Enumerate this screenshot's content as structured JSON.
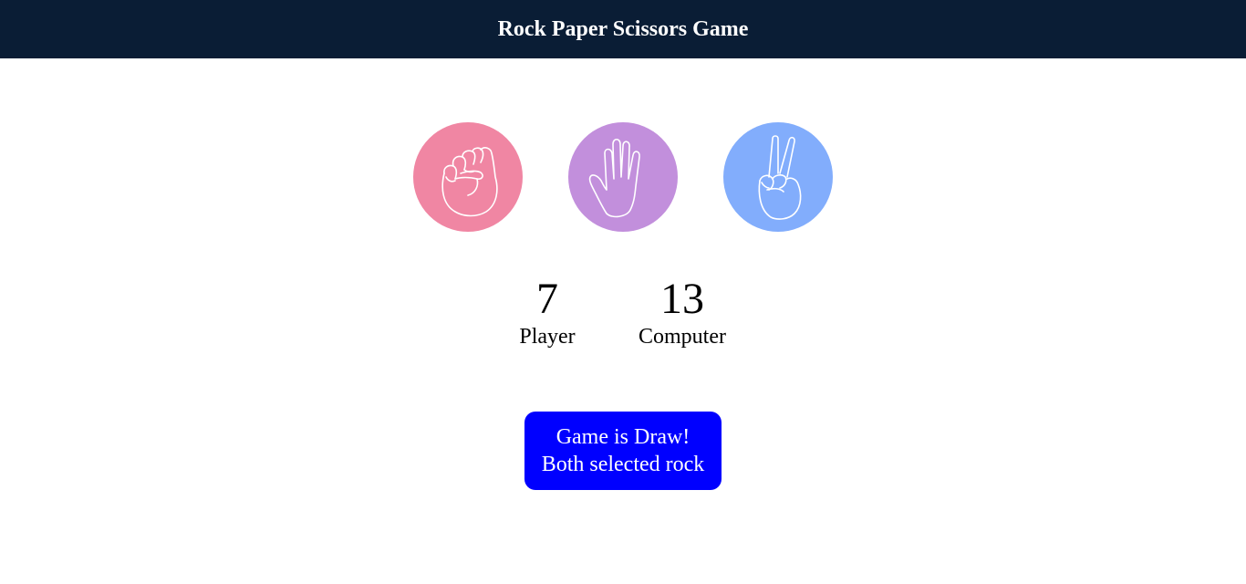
{
  "header": {
    "title": "Rock Paper Scissors Game"
  },
  "choices": [
    {
      "name": "rock",
      "icon": "fist-icon",
      "color": "#f086a3"
    },
    {
      "name": "paper",
      "icon": "open-hand-icon",
      "color": "#c28fdc"
    },
    {
      "name": "scissors",
      "icon": "peace-hand-icon",
      "color": "#82adfc"
    }
  ],
  "scores": {
    "player": {
      "value": "7",
      "label": "Player"
    },
    "computer": {
      "value": "13",
      "label": "Computer"
    }
  },
  "result": {
    "line1": "Game is Draw!",
    "line2": "Both selected rock",
    "color": "#0000ff"
  },
  "colors": {
    "header_bg": "#0a1d35"
  }
}
